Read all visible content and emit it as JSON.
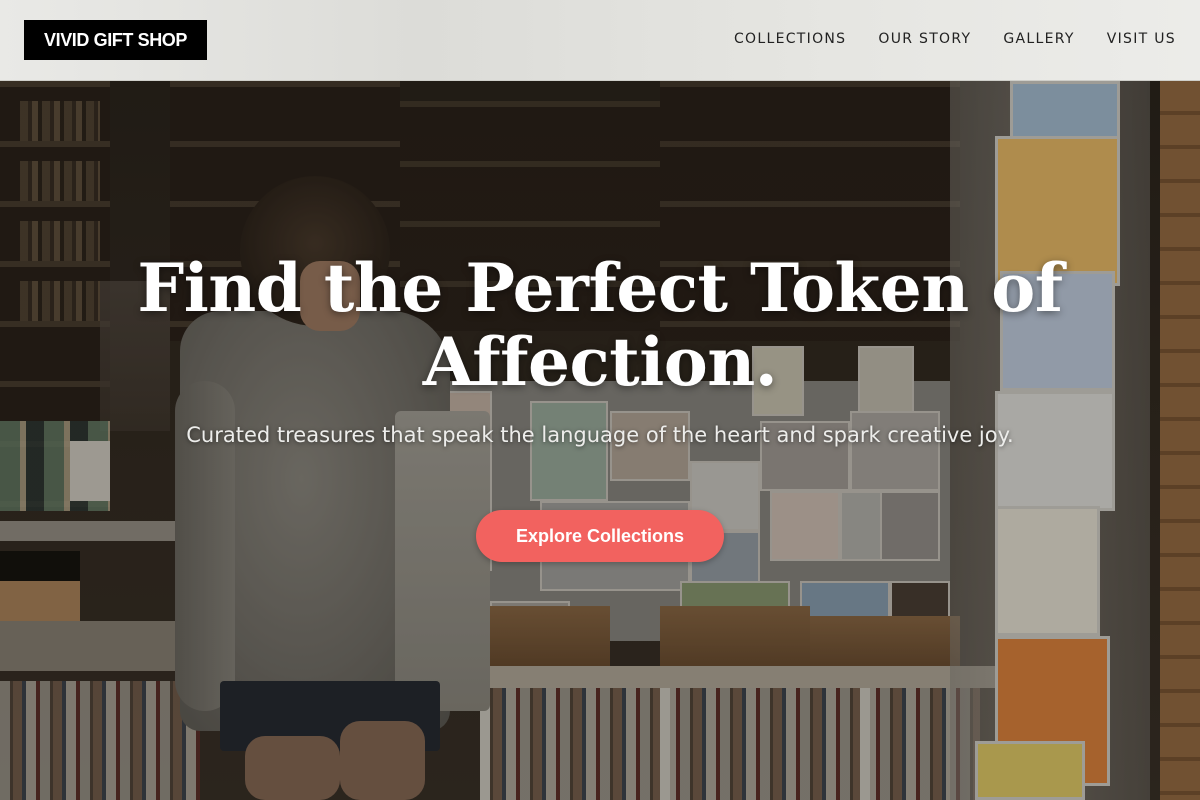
{
  "header": {
    "logo": "VIVID GIFT SHOP",
    "nav": [
      {
        "label": "COLLECTIONS"
      },
      {
        "label": "OUR STORY"
      },
      {
        "label": "GALLERY"
      },
      {
        "label": "VISIT US"
      }
    ]
  },
  "hero": {
    "title": "Find the Perfect Token of Affection.",
    "subtitle": "Curated treasures that speak the language of the heart and spark creative joy.",
    "cta_label": "Explore Collections",
    "cta_color": "#f2625f",
    "background_image": "shop-interior-photo"
  }
}
